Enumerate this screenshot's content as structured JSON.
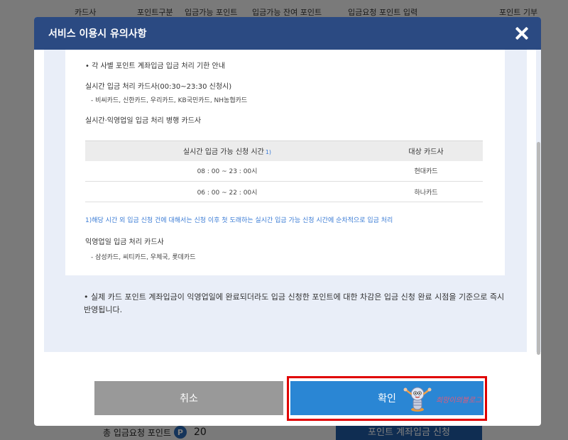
{
  "background": {
    "header_tabs": [
      "카드사",
      "포인트구분",
      "입금가능 포인트",
      "입금가능 잔여 포인트",
      "입금요청 포인트 입력",
      "포인트 기부"
    ],
    "total_label": "총 입금요청 포인트",
    "point_badge": "P",
    "total_value": "20",
    "apply_button": "포인트 계좌입금 신청"
  },
  "modal": {
    "title": "서비스 이용시 유의사항",
    "section_title": "• 각 사별 포인트 계좌입금 입금 처리 기한 안내",
    "realtime_title": "실시간 입금 처리 카드사(00:30~23:30 신청시)",
    "realtime_cards": "- 비씨카드, 신한카드, 우리카드, KB국민카드, NH농협카드",
    "parallel_title": "실시간·익영업일 입금 처리 병행 카드사",
    "table": {
      "headers": [
        "실시간 입금 가능 신청 시간",
        "대상 카드사"
      ],
      "header_sup": "1)",
      "rows": [
        [
          "08 : 00 ~ 23 : 00시",
          "현대카드"
        ],
        [
          "06 : 00 ~ 22 : 00시",
          "하나카드"
        ]
      ]
    },
    "footnote": "1)해당 시간 외 입금 신청 건에 대해서는 신청 이후 첫 도래하는 실시간 입금 가능 신청 시간에 순차적으로 입금 처리",
    "nextday_title": "익영업일 입금 처리 카드사",
    "nextday_cards": "- 삼성카드, 씨티카드, 우체국, 롯데카드",
    "notice": "• 실제 카드 포인트 계좌입금이 익영업일에 완료되더라도 입금 신청한 포인트에 대한 차감은 입금 신청 완료 시점을 기준으로 즉시 반영됩니다.",
    "cancel_label": "취소",
    "confirm_label": "확인"
  },
  "watermark_text": "희망이의블로그",
  "colors": {
    "header": "#2b4a82",
    "confirm": "#2a86d4",
    "cancel": "#999999",
    "highlight": "#e00000",
    "footnote": "#3a7bd5"
  }
}
